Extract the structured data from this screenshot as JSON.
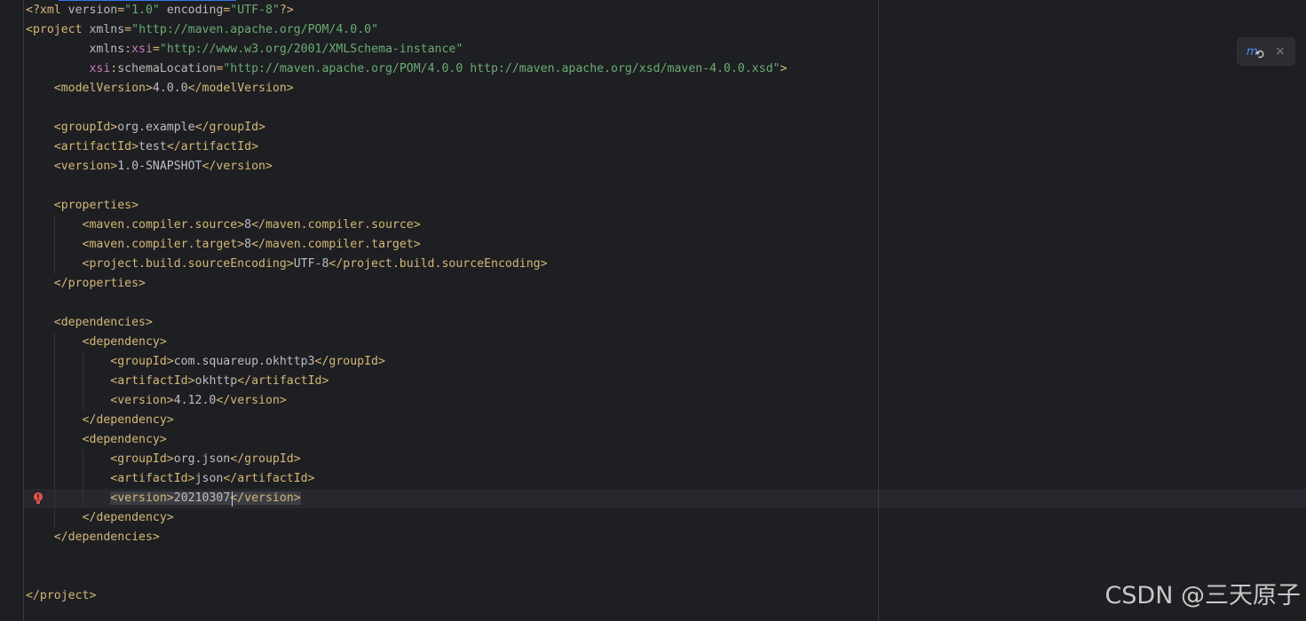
{
  "editor": {
    "language": "xml",
    "theme": "dark",
    "caret_line": 26,
    "error_line": 26,
    "lines": [
      [
        {
          "t": "tag",
          "v": "<?xml "
        },
        {
          "t": "attr",
          "v": "version"
        },
        {
          "t": "tag",
          "v": "="
        },
        {
          "t": "str",
          "v": "\"1.0\""
        },
        {
          "t": "attr",
          "v": " encoding"
        },
        {
          "t": "tag",
          "v": "="
        },
        {
          "t": "str",
          "v": "\"UTF-8\""
        },
        {
          "t": "tag",
          "v": "?>"
        }
      ],
      [
        {
          "t": "tag",
          "v": "<project "
        },
        {
          "t": "attr",
          "v": "xmlns"
        },
        {
          "t": "tag",
          "v": "="
        },
        {
          "t": "str",
          "v": "\"http://maven.apache.org/POM/4.0.0\""
        }
      ],
      [
        {
          "t": "attr",
          "v": "         xmlns"
        },
        {
          "t": "tag",
          "v": ":"
        },
        {
          "t": "ns",
          "v": "xsi"
        },
        {
          "t": "tag",
          "v": "="
        },
        {
          "t": "str",
          "v": "\"http://www.w3.org/2001/XMLSchema-instance\""
        }
      ],
      [
        {
          "t": "ns",
          "v": "         xsi"
        },
        {
          "t": "tag",
          "v": ":"
        },
        {
          "t": "attr",
          "v": "schemaLocation"
        },
        {
          "t": "tag",
          "v": "="
        },
        {
          "t": "str",
          "v": "\"http://maven.apache.org/POM/4.0.0 http://maven.apache.org/xsd/maven-4.0.0.xsd\""
        },
        {
          "t": "tag",
          "v": ">"
        }
      ],
      [
        {
          "t": "tag",
          "v": "    <modelVersion>"
        },
        {
          "t": "text",
          "v": "4.0.0"
        },
        {
          "t": "tag",
          "v": "</modelVersion>"
        }
      ],
      [],
      [
        {
          "t": "tag",
          "v": "    <groupId>"
        },
        {
          "t": "text",
          "v": "org.example"
        },
        {
          "t": "tag",
          "v": "</groupId>"
        }
      ],
      [
        {
          "t": "tag",
          "v": "    <artifactId>"
        },
        {
          "t": "text",
          "v": "test"
        },
        {
          "t": "tag",
          "v": "</artifactId>"
        }
      ],
      [
        {
          "t": "tag",
          "v": "    <version>"
        },
        {
          "t": "text",
          "v": "1.0-SNAPSHOT"
        },
        {
          "t": "tag",
          "v": "</version>"
        }
      ],
      [],
      [
        {
          "t": "tag",
          "v": "    <properties>"
        }
      ],
      [
        {
          "t": "tag",
          "v": "        <maven.compiler.source>"
        },
        {
          "t": "text",
          "v": "8"
        },
        {
          "t": "tag",
          "v": "</maven.compiler.source>"
        }
      ],
      [
        {
          "t": "tag",
          "v": "        <maven.compiler.target>"
        },
        {
          "t": "text",
          "v": "8"
        },
        {
          "t": "tag",
          "v": "</maven.compiler.target>"
        }
      ],
      [
        {
          "t": "tag",
          "v": "        <project.build.sourceEncoding>"
        },
        {
          "t": "text",
          "v": "UTF-8"
        },
        {
          "t": "tag",
          "v": "</project.build.sourceEncoding>"
        }
      ],
      [
        {
          "t": "tag",
          "v": "    </properties>"
        }
      ],
      [],
      [
        {
          "t": "tag",
          "v": "    <dependencies>"
        }
      ],
      [
        {
          "t": "tag",
          "v": "        <dependency>"
        }
      ],
      [
        {
          "t": "tag",
          "v": "            <groupId>"
        },
        {
          "t": "text",
          "v": "com.squareup.okhttp3"
        },
        {
          "t": "tag",
          "v": "</groupId>"
        }
      ],
      [
        {
          "t": "tag",
          "v": "            <artifactId>"
        },
        {
          "t": "text",
          "v": "okhttp"
        },
        {
          "t": "tag",
          "v": "</artifactId>"
        }
      ],
      [
        {
          "t": "tag",
          "v": "            <version>"
        },
        {
          "t": "text",
          "v": "4.12.0"
        },
        {
          "t": "tag",
          "v": "</version>"
        }
      ],
      [
        {
          "t": "tag",
          "v": "        </dependency>"
        }
      ],
      [
        {
          "t": "tag",
          "v": "        <dependency>"
        }
      ],
      [
        {
          "t": "tag",
          "v": "            <groupId>"
        },
        {
          "t": "text",
          "v": "org.json"
        },
        {
          "t": "tag",
          "v": "</groupId>"
        }
      ],
      [
        {
          "t": "tag",
          "v": "            <artifactId>"
        },
        {
          "t": "text",
          "v": "json"
        },
        {
          "t": "tag",
          "v": "</artifactId>"
        }
      ],
      [
        {
          "t": "tag",
          "v": "            "
        },
        {
          "t": "tag",
          "v": "<version>",
          "hl": true
        },
        {
          "t": "text",
          "v": "20210307",
          "hl": true
        },
        {
          "t": "tag",
          "v": "</version>",
          "hl": true
        }
      ],
      [
        {
          "t": "tag",
          "v": "        </dependency>"
        }
      ],
      [
        {
          "t": "tag",
          "v": "    </dependencies>"
        }
      ],
      [],
      [],
      [
        {
          "t": "tag",
          "v": "</project>"
        }
      ]
    ]
  },
  "popup": {
    "icon": "maven-reload-icon",
    "close_label": "×"
  },
  "watermark": {
    "text": "CSDN @三天原子"
  },
  "colors": {
    "background": "#1e1f22",
    "tag": "#d5b778",
    "attribute": "#bababa",
    "namespace": "#c77dbb",
    "string": "#6aab73",
    "text": "#bcbec4",
    "error": "#e5534b",
    "accent": "#3574f0"
  }
}
